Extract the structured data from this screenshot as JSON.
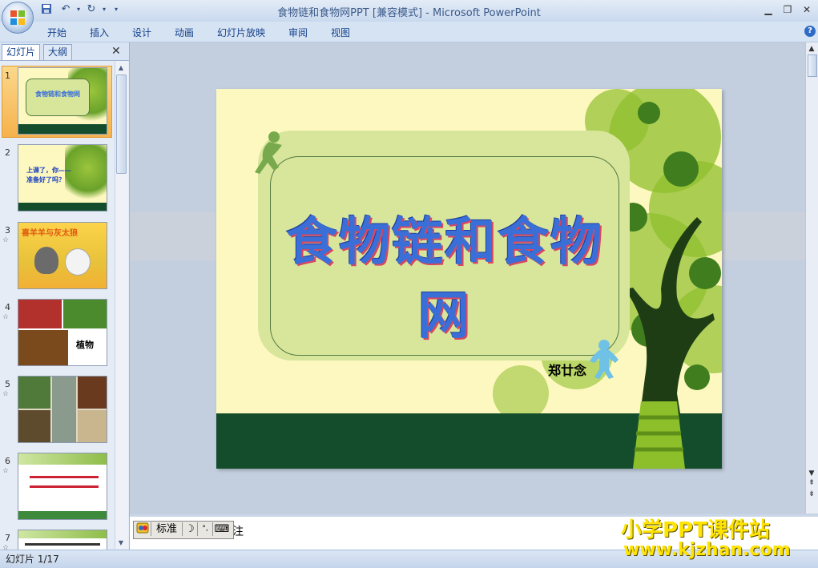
{
  "app": {
    "window_title": "食物链和食物网PPT [兼容模式] - Microsoft PowerPoint",
    "qat": [
      "save-icon",
      "undo-icon",
      "redo-icon",
      "customize-icon"
    ],
    "window_controls": [
      "minimize",
      "restore",
      "close"
    ]
  },
  "ribbon": {
    "tabs": [
      "开始",
      "插入",
      "设计",
      "动画",
      "幻灯片放映",
      "审阅",
      "视图"
    ],
    "help_label": "?"
  },
  "panel": {
    "tabs": [
      "幻灯片",
      "大纲"
    ],
    "close_label": "✕",
    "slides": [
      {
        "number": "1",
        "animated": false,
        "text": "食物链和食物网"
      },
      {
        "number": "2",
        "animated": false,
        "text": "上课了，你——准备好了吗？"
      },
      {
        "number": "3",
        "animated": true,
        "text": "喜羊羊与灰太狼"
      },
      {
        "number": "4",
        "animated": true,
        "text": "植物"
      },
      {
        "number": "5",
        "animated": true,
        "text": ""
      },
      {
        "number": "6",
        "animated": true,
        "text": ""
      },
      {
        "number": "7",
        "animated": true,
        "text": ""
      }
    ]
  },
  "slide": {
    "title": "食物链和食物网",
    "author": "郑廿念"
  },
  "ime": {
    "mode": "标准",
    "moon": "☽",
    "punct": "°,",
    "keyboard": "⌨",
    "notes_partial": "注"
  },
  "status": {
    "slide_counter": "幻灯片 1/17"
  },
  "watermark": {
    "line1": "小学PPT课件站",
    "line2": "www.kjzhan.com"
  },
  "colors": {
    "ribbon_text": "#15428b",
    "slide_bg": "#fdf8c0",
    "slide_ground": "#134d2c",
    "card": "#d8e69b",
    "title_blue": "#3b6fd8",
    "title_red": "#d9465f",
    "selected_thumb": "#f6b24d",
    "watermark_yellow": "#ffe400"
  }
}
